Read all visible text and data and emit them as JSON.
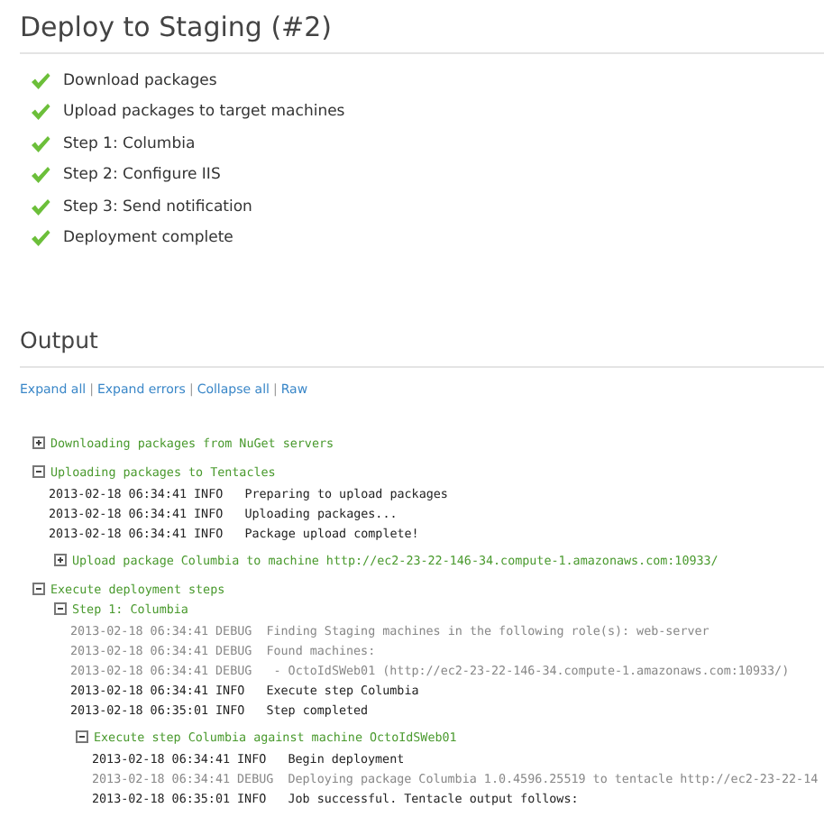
{
  "title": "Deploy to Staging (#2)",
  "steps": [
    {
      "label": "Download packages",
      "done": true
    },
    {
      "label": "Upload packages to target machines",
      "done": true
    },
    {
      "label": "Step 1: Columbia",
      "done": true
    },
    {
      "label": "Step 2: Configure IIS",
      "done": true
    },
    {
      "label": "Step 3: Send notification",
      "done": true
    },
    {
      "label": "Deployment complete",
      "done": true
    }
  ],
  "output": {
    "heading": "Output",
    "links": [
      {
        "label": "Expand all"
      },
      {
        "separator": "|",
        "label": "Expand errors"
      },
      {
        "separator": "|",
        "label": "Collapse all"
      },
      {
        "separator": "|",
        "label": "Raw"
      }
    ],
    "groups": [
      {
        "title": "Downloading packages from NuGet servers",
        "expanded": false
      },
      {
        "title": "Uploading packages to Tentacles",
        "expanded": true,
        "entries": [
          {
            "kind": "info",
            "time": "2013-02-18 06:34:41",
            "severity": "INFO",
            "message": "Preparing to upload packages"
          },
          {
            "kind": "info",
            "time": "2013-02-18 06:34:41",
            "severity": "INFO",
            "message": "Uploading packages..."
          },
          {
            "kind": "info",
            "time": "2013-02-18 06:34:41",
            "severity": "INFO",
            "message": "Package upload complete!"
          }
        ],
        "children": [
          {
            "title": "Upload package Columbia to machine http://ec2-23-22-146-34.compute-1.amazonaws.com:10933/",
            "expanded": false
          }
        ]
      },
      {
        "title": "Execute deployment steps",
        "expanded": true,
        "children": [
          {
            "title": "Step 1: Columbia",
            "expanded": true,
            "entries": [
              {
                "kind": "debug",
                "time": "2013-02-18 06:34:41",
                "severity": "DEBUG",
                "message": "Finding Staging machines in the following role(s): web-server"
              },
              {
                "kind": "debug",
                "time": "2013-02-18 06:34:41",
                "severity": "DEBUG",
                "message": "Found machines:"
              },
              {
                "kind": "debug",
                "time": "2013-02-18 06:34:41",
                "severity": "DEBUG",
                "message": " - OctoIdSWeb01 (http://ec2-23-22-146-34.compute-1.amazonaws.com:10933/)"
              },
              {
                "kind": "info",
                "time": "2013-02-18 06:34:41",
                "severity": "INFO",
                "message": "Execute step Columbia"
              },
              {
                "kind": "info",
                "time": "2013-02-18 06:35:01",
                "severity": "INFO",
                "message": "Step completed"
              }
            ],
            "children": [
              {
                "title": "Execute step Columbia against machine OctoIdSWeb01",
                "expanded": true,
                "entries": [
                  {
                    "kind": "info",
                    "time": "2013-02-18 06:34:41",
                    "severity": "INFO",
                    "message": "Begin deployment"
                  },
                  {
                    "kind": "debug",
                    "time": "2013-02-18 06:34:41",
                    "severity": "DEBUG",
                    "message": "Deploying package Columbia 1.0.4596.25519 to tentacle http://ec2-23-22-14"
                  },
                  {
                    "kind": "info",
                    "time": "2013-02-18 06:35:01",
                    "severity": "INFO",
                    "message": "Job successful. Tentacle output follows:"
                  }
                ]
              }
            ]
          }
        ]
      }
    ]
  }
}
